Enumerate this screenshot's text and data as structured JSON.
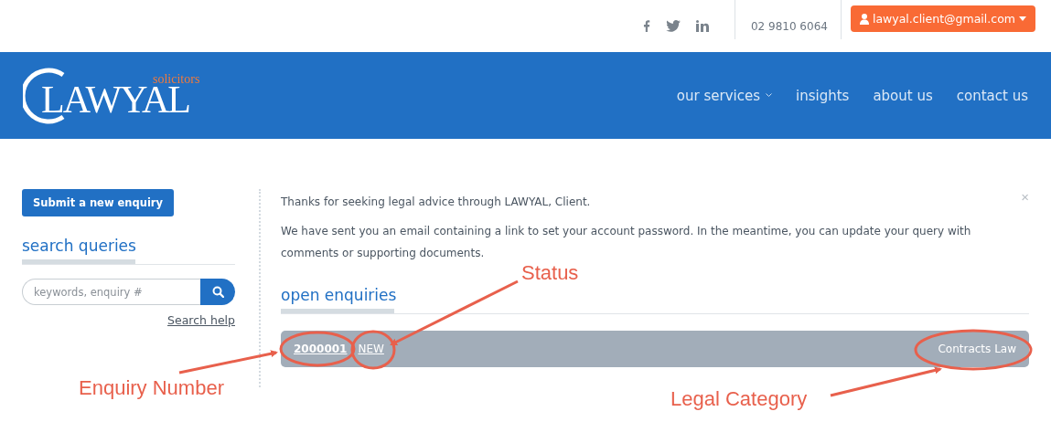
{
  "topbar": {
    "social": [
      {
        "kind": "facebook"
      },
      {
        "kind": "twitter"
      },
      {
        "kind": "linkedin"
      }
    ],
    "phone": "02 9810 6064",
    "account": "lawyal.client@gmail.com"
  },
  "header": {
    "logo": "LAWYAL",
    "logo_tag": "solicitors",
    "nav": [
      {
        "label": "our services",
        "dropdown": true
      },
      {
        "label": "insights",
        "dropdown": false
      },
      {
        "label": "about us",
        "dropdown": false
      },
      {
        "label": "contact us",
        "dropdown": false
      }
    ]
  },
  "sidebar": {
    "button": "Submit a new enquiry",
    "heading": "search queries",
    "search": {
      "placeholder": "keywords, enquiry #"
    },
    "help_link": "Search help"
  },
  "notice": {
    "lines": [
      "Thanks for seeking legal advice through LAWYAL, Client.",
      "We have sent you an email containing a link to set your account password. In the meantime, you can update your query with comments or supporting documents."
    ],
    "close": "×"
  },
  "enquiries": {
    "heading": "open enquiries",
    "rows": [
      {
        "number": "2000001",
        "status": "NEW",
        "category": "Contracts Law"
      }
    ]
  },
  "annotations": [
    {
      "label": "Enquiry Number"
    },
    {
      "label": "Status"
    },
    {
      "label": "Legal Category"
    }
  ]
}
